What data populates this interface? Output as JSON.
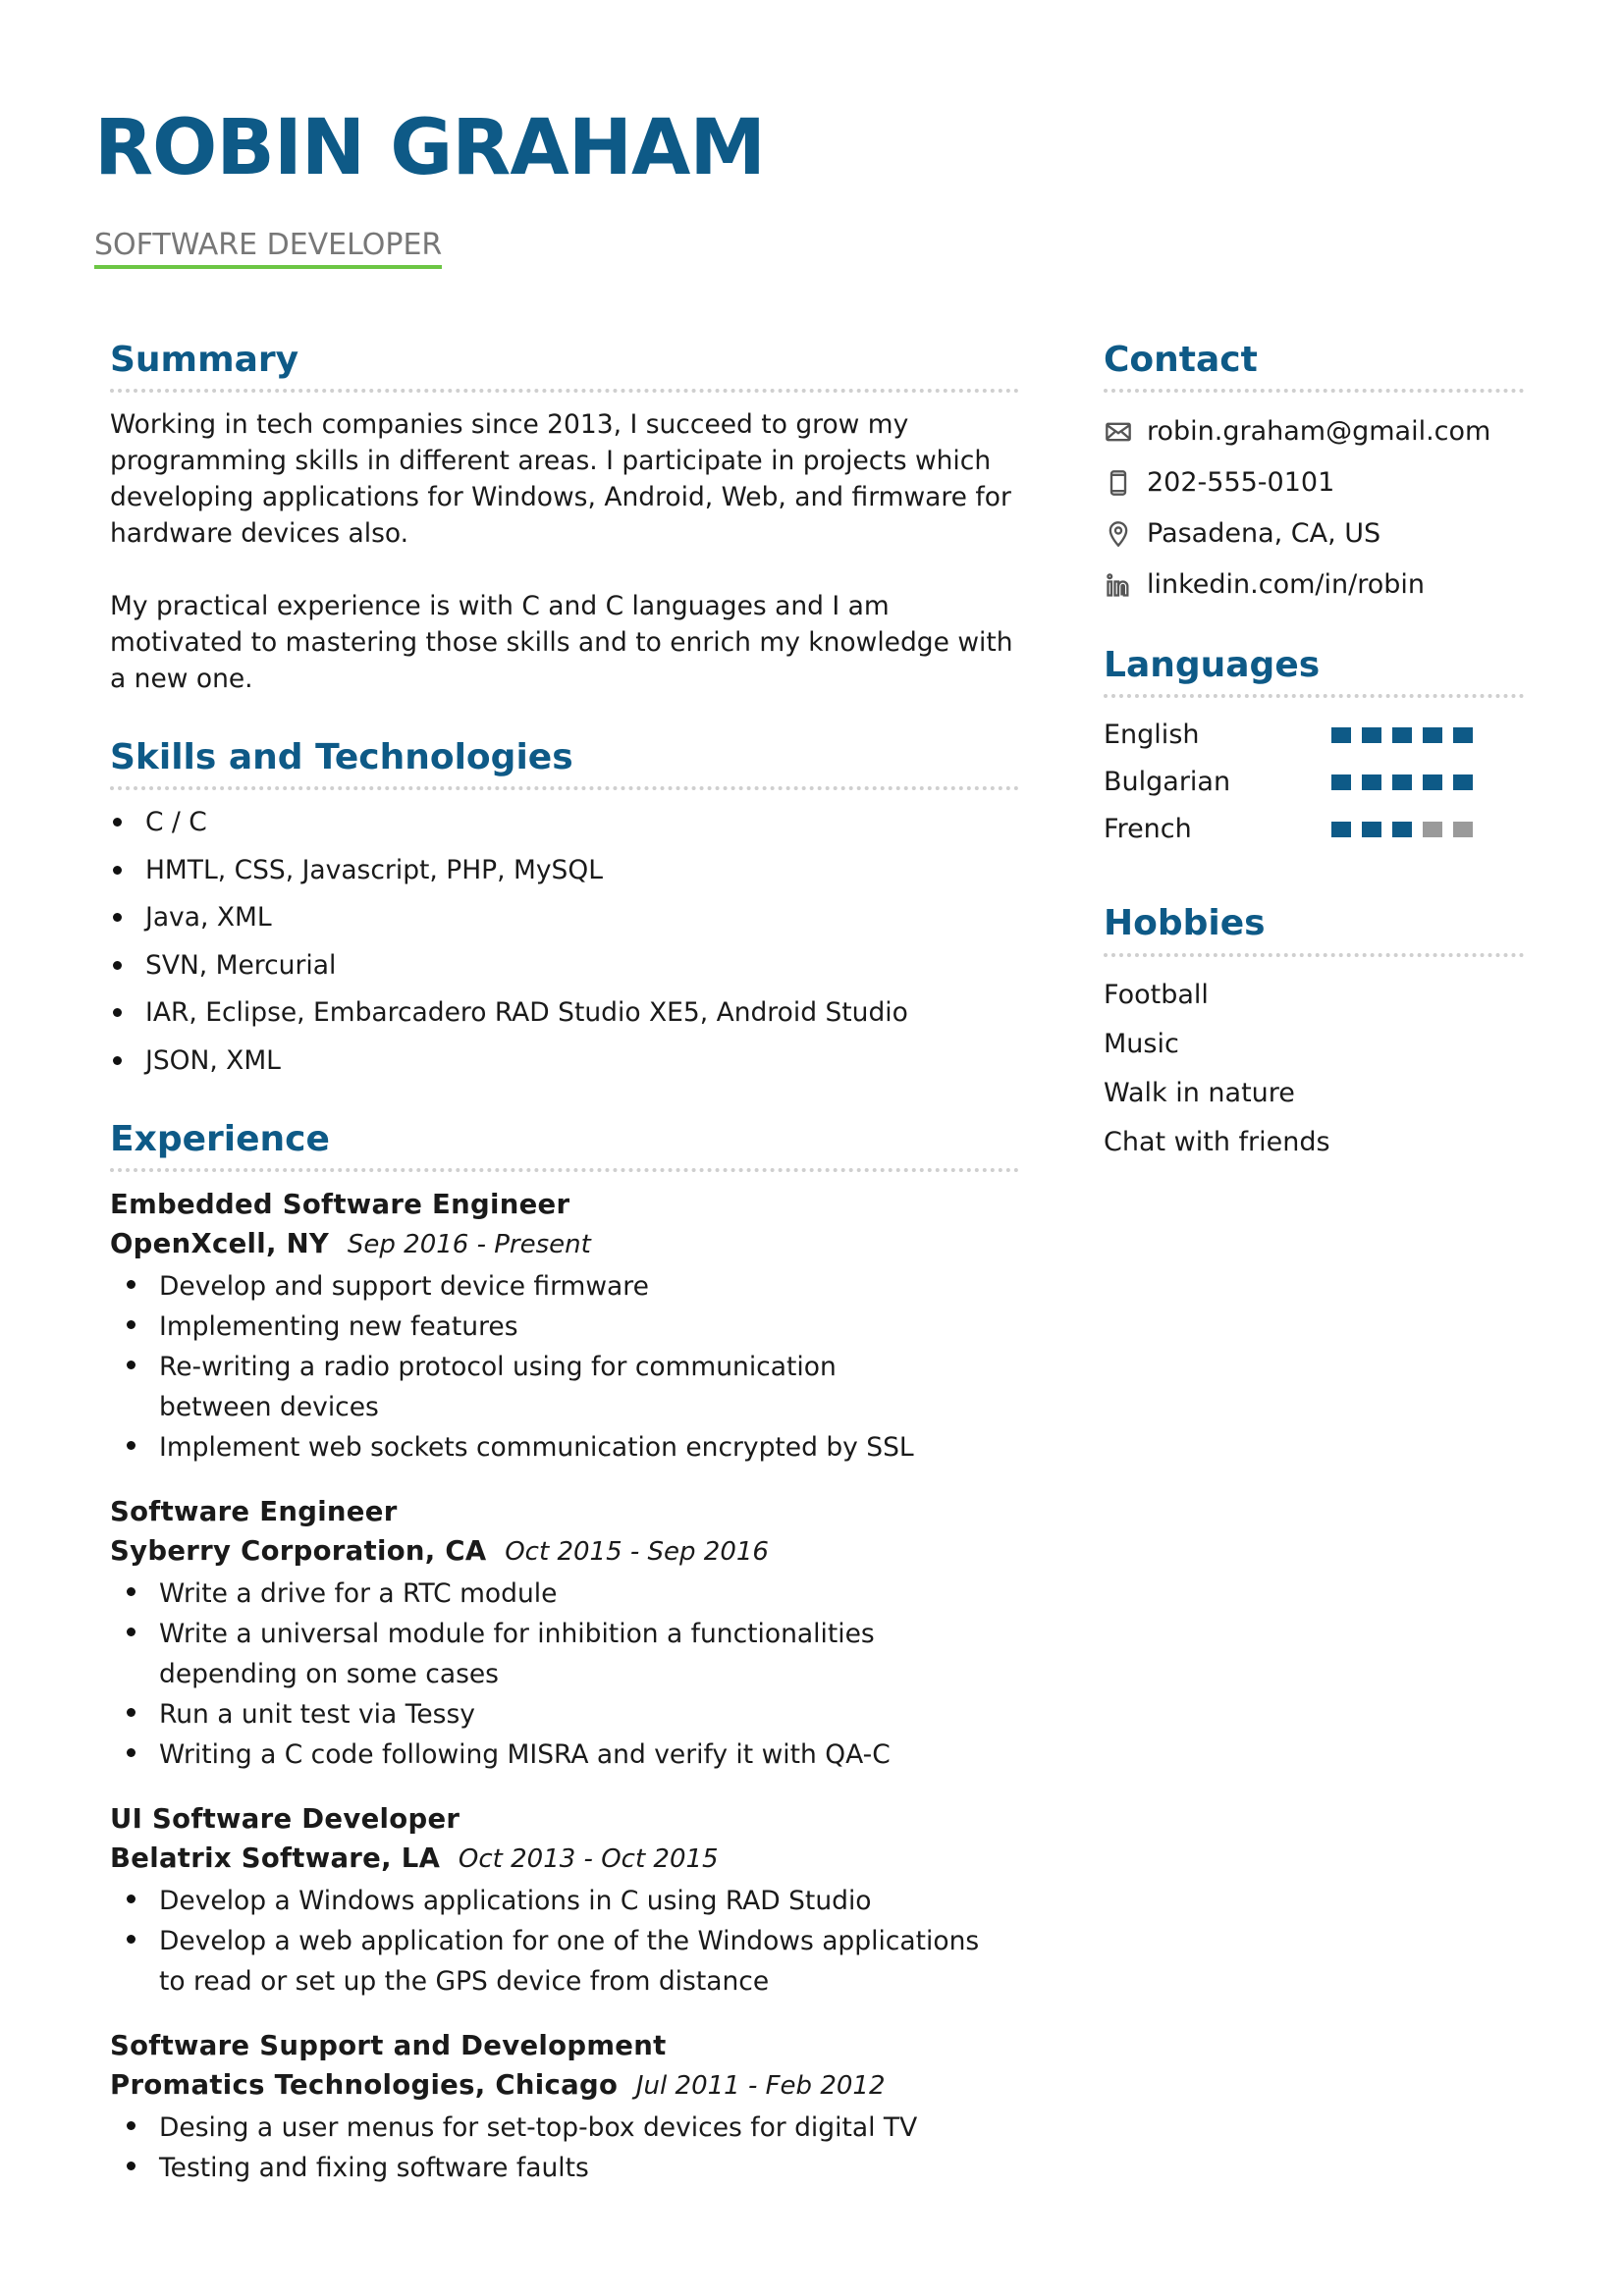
{
  "header": {
    "name": "ROBIN GRAHAM",
    "title": "SOFTWARE DEVELOPER"
  },
  "colors": {
    "accent": "#0e5a87",
    "underline": "#6cc644",
    "rating_off": "#9a9a9a"
  },
  "summary": {
    "heading": "Summary",
    "paragraphs": [
      "Working in tech companies since 2013, I succeed to grow my programming skills in different areas. I participate in projects which developing applications for Windows, Android, Web, and firmware for hardware devices also.",
      "My practical experience is with C and C languages and I am motivated to mastering those skills and to enrich my knowledge with a new one."
    ]
  },
  "skills": {
    "heading": "Skills and Technologies",
    "items": [
      "C / C",
      "HMTL, CSS, Javascript, PHP, MySQL",
      "Java, XML",
      "SVN, Mercurial",
      "IAR, Eclipse, Embarcadero RAD Studio XE5, Android Studio",
      "JSON, XML"
    ]
  },
  "experience": {
    "heading": "Experience",
    "jobs": [
      {
        "title": "Embedded Software Engineer",
        "company": "OpenXcell, NY",
        "dates": "Sep 2016 - Present",
        "bullets": [
          "Develop and support device firmware",
          "Implementing new features",
          "Re-writing a radio protocol using for communication between devices",
          "Implement web sockets communication encrypted by SSL"
        ]
      },
      {
        "title": "Software Engineer",
        "company": "Syberry Corporation, CA",
        "dates": "Oct 2015 - Sep 2016",
        "bullets": [
          "Write a drive for a RTC module",
          "Write a universal module for inhibition a functionalities depending on some cases",
          "Run a unit test via Tessy",
          "Writing a C code following MISRA and verify it with QA-C"
        ]
      },
      {
        "title": "UI Software Developer",
        "company": "Belatrix Software, LA",
        "dates": "Oct 2013 - Oct 2015",
        "bullets": [
          "Develop a Windows applications in C using RAD Studio",
          "Develop a web application for one of the Windows applications to read or set up the GPS device from distance"
        ]
      },
      {
        "title": "Software Support and Development",
        "company": "Promatics Technologies, Chicago",
        "dates": "Jul 2011 - Feb 2012",
        "bullets": [
          "Desing a user menus for set-top-box devices for digital TV",
          "Testing and fixing software faults"
        ]
      }
    ]
  },
  "contact": {
    "heading": "Contact",
    "items": [
      {
        "icon": "envelope-icon",
        "text": "robin.graham@gmail.com"
      },
      {
        "icon": "phone-icon",
        "text": "202-555-0101"
      },
      {
        "icon": "location-pin-icon",
        "text": "Pasadena, CA, US"
      },
      {
        "icon": "linkedin-icon",
        "text": "linkedin.com/in/robin"
      }
    ]
  },
  "languages": {
    "heading": "Languages",
    "scale_max": 5,
    "items": [
      {
        "name": "English",
        "level": 5
      },
      {
        "name": "Bulgarian",
        "level": 5
      },
      {
        "name": "French",
        "level": 3
      }
    ]
  },
  "hobbies": {
    "heading": "Hobbies",
    "items": [
      "Football",
      "Music",
      "Walk in nature",
      "Chat with friends"
    ]
  }
}
